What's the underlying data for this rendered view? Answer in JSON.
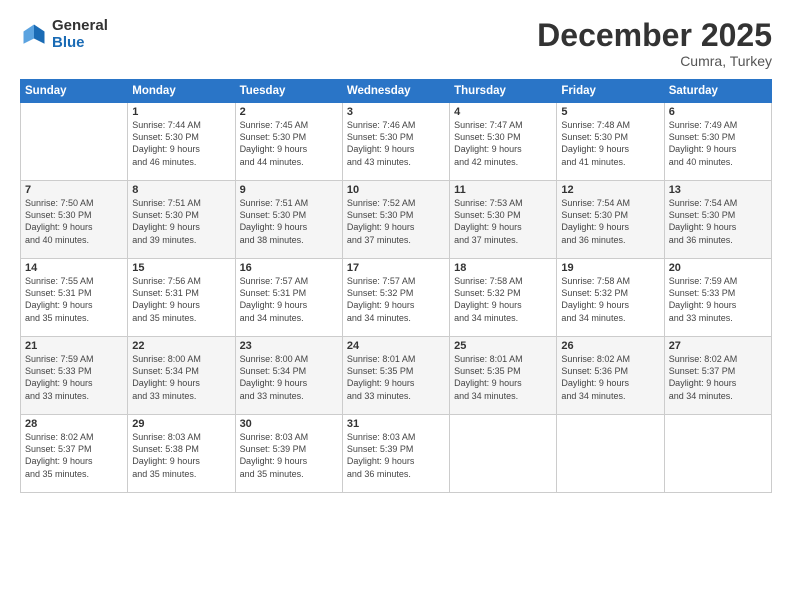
{
  "logo": {
    "general": "General",
    "blue": "Blue"
  },
  "header": {
    "month": "December 2025",
    "location": "Cumra, Turkey"
  },
  "days_of_week": [
    "Sunday",
    "Monday",
    "Tuesday",
    "Wednesday",
    "Thursday",
    "Friday",
    "Saturday"
  ],
  "weeks": [
    [
      {
        "day": "",
        "info": ""
      },
      {
        "day": "1",
        "info": "Sunrise: 7:44 AM\nSunset: 5:30 PM\nDaylight: 9 hours\nand 46 minutes."
      },
      {
        "day": "2",
        "info": "Sunrise: 7:45 AM\nSunset: 5:30 PM\nDaylight: 9 hours\nand 44 minutes."
      },
      {
        "day": "3",
        "info": "Sunrise: 7:46 AM\nSunset: 5:30 PM\nDaylight: 9 hours\nand 43 minutes."
      },
      {
        "day": "4",
        "info": "Sunrise: 7:47 AM\nSunset: 5:30 PM\nDaylight: 9 hours\nand 42 minutes."
      },
      {
        "day": "5",
        "info": "Sunrise: 7:48 AM\nSunset: 5:30 PM\nDaylight: 9 hours\nand 41 minutes."
      },
      {
        "day": "6",
        "info": "Sunrise: 7:49 AM\nSunset: 5:30 PM\nDaylight: 9 hours\nand 40 minutes."
      }
    ],
    [
      {
        "day": "7",
        "info": "Sunrise: 7:50 AM\nSunset: 5:30 PM\nDaylight: 9 hours\nand 40 minutes."
      },
      {
        "day": "8",
        "info": "Sunrise: 7:51 AM\nSunset: 5:30 PM\nDaylight: 9 hours\nand 39 minutes."
      },
      {
        "day": "9",
        "info": "Sunrise: 7:51 AM\nSunset: 5:30 PM\nDaylight: 9 hours\nand 38 minutes."
      },
      {
        "day": "10",
        "info": "Sunrise: 7:52 AM\nSunset: 5:30 PM\nDaylight: 9 hours\nand 37 minutes."
      },
      {
        "day": "11",
        "info": "Sunrise: 7:53 AM\nSunset: 5:30 PM\nDaylight: 9 hours\nand 37 minutes."
      },
      {
        "day": "12",
        "info": "Sunrise: 7:54 AM\nSunset: 5:30 PM\nDaylight: 9 hours\nand 36 minutes."
      },
      {
        "day": "13",
        "info": "Sunrise: 7:54 AM\nSunset: 5:30 PM\nDaylight: 9 hours\nand 36 minutes."
      }
    ],
    [
      {
        "day": "14",
        "info": "Sunrise: 7:55 AM\nSunset: 5:31 PM\nDaylight: 9 hours\nand 35 minutes."
      },
      {
        "day": "15",
        "info": "Sunrise: 7:56 AM\nSunset: 5:31 PM\nDaylight: 9 hours\nand 35 minutes."
      },
      {
        "day": "16",
        "info": "Sunrise: 7:57 AM\nSunset: 5:31 PM\nDaylight: 9 hours\nand 34 minutes."
      },
      {
        "day": "17",
        "info": "Sunrise: 7:57 AM\nSunset: 5:32 PM\nDaylight: 9 hours\nand 34 minutes."
      },
      {
        "day": "18",
        "info": "Sunrise: 7:58 AM\nSunset: 5:32 PM\nDaylight: 9 hours\nand 34 minutes."
      },
      {
        "day": "19",
        "info": "Sunrise: 7:58 AM\nSunset: 5:32 PM\nDaylight: 9 hours\nand 34 minutes."
      },
      {
        "day": "20",
        "info": "Sunrise: 7:59 AM\nSunset: 5:33 PM\nDaylight: 9 hours\nand 33 minutes."
      }
    ],
    [
      {
        "day": "21",
        "info": "Sunrise: 7:59 AM\nSunset: 5:33 PM\nDaylight: 9 hours\nand 33 minutes."
      },
      {
        "day": "22",
        "info": "Sunrise: 8:00 AM\nSunset: 5:34 PM\nDaylight: 9 hours\nand 33 minutes."
      },
      {
        "day": "23",
        "info": "Sunrise: 8:00 AM\nSunset: 5:34 PM\nDaylight: 9 hours\nand 33 minutes."
      },
      {
        "day": "24",
        "info": "Sunrise: 8:01 AM\nSunset: 5:35 PM\nDaylight: 9 hours\nand 33 minutes."
      },
      {
        "day": "25",
        "info": "Sunrise: 8:01 AM\nSunset: 5:35 PM\nDaylight: 9 hours\nand 34 minutes."
      },
      {
        "day": "26",
        "info": "Sunrise: 8:02 AM\nSunset: 5:36 PM\nDaylight: 9 hours\nand 34 minutes."
      },
      {
        "day": "27",
        "info": "Sunrise: 8:02 AM\nSunset: 5:37 PM\nDaylight: 9 hours\nand 34 minutes."
      }
    ],
    [
      {
        "day": "28",
        "info": "Sunrise: 8:02 AM\nSunset: 5:37 PM\nDaylight: 9 hours\nand 35 minutes."
      },
      {
        "day": "29",
        "info": "Sunrise: 8:03 AM\nSunset: 5:38 PM\nDaylight: 9 hours\nand 35 minutes."
      },
      {
        "day": "30",
        "info": "Sunrise: 8:03 AM\nSunset: 5:39 PM\nDaylight: 9 hours\nand 35 minutes."
      },
      {
        "day": "31",
        "info": "Sunrise: 8:03 AM\nSunset: 5:39 PM\nDaylight: 9 hours\nand 36 minutes."
      },
      {
        "day": "",
        "info": ""
      },
      {
        "day": "",
        "info": ""
      },
      {
        "day": "",
        "info": ""
      }
    ]
  ]
}
